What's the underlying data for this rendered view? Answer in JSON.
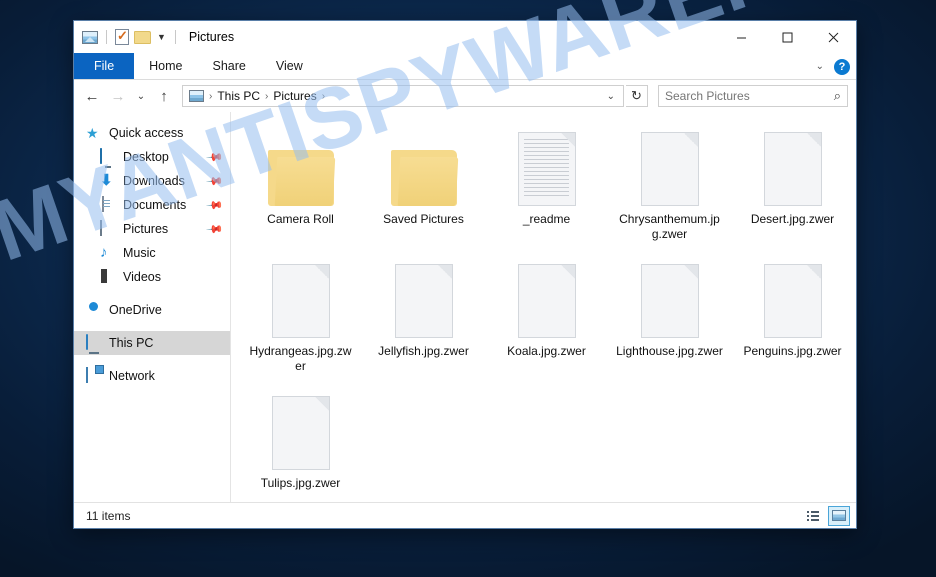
{
  "desktop": {
    "background_color": "#0b2344"
  },
  "watermark": {
    "text": "MYANTISPYWARE.COM"
  },
  "window": {
    "title": "Pictures",
    "quick_access_toolbar": [
      {
        "name": "pictures-library-icon",
        "label": "Pictures library"
      },
      {
        "name": "properties-icon",
        "label": "Properties"
      },
      {
        "name": "new-folder-icon",
        "label": "New folder"
      },
      {
        "name": "customize-chevron-icon",
        "label": "Customize Quick Access Toolbar"
      }
    ],
    "controls": {
      "minimize": "Minimize",
      "maximize": "Maximize",
      "close": "Close"
    }
  },
  "ribbon": {
    "tabs": [
      {
        "label": "File",
        "selected": true
      },
      {
        "label": "Home",
        "selected": false
      },
      {
        "label": "Share",
        "selected": false
      },
      {
        "label": "View",
        "selected": false
      }
    ],
    "expand_label": "Expand the Ribbon",
    "help_label": "?"
  },
  "addressbar": {
    "back": "Back",
    "forward": "Forward",
    "recent": "Recent locations",
    "up": "Up",
    "breadcrumb": [
      "This PC",
      "Pictures"
    ],
    "breadcrumb_separator": "›",
    "refresh": "Refresh",
    "dropdown": "Previous locations"
  },
  "search": {
    "placeholder": "Search Pictures",
    "value": "",
    "icon": "search-icon"
  },
  "sidebar": {
    "items": [
      {
        "label": "Quick access",
        "icon": "star-icon",
        "indent": false,
        "pinned": false,
        "selected": false
      },
      {
        "label": "Desktop",
        "icon": "monitor-icon",
        "indent": true,
        "pinned": true,
        "selected": false
      },
      {
        "label": "Downloads",
        "icon": "download-arrow-icon",
        "indent": true,
        "pinned": true,
        "selected": false
      },
      {
        "label": "Documents",
        "icon": "document-icon",
        "indent": true,
        "pinned": true,
        "selected": false
      },
      {
        "label": "Pictures",
        "icon": "picture-icon",
        "indent": true,
        "pinned": true,
        "selected": false
      },
      {
        "label": "Music",
        "icon": "music-note-icon",
        "indent": true,
        "pinned": false,
        "selected": false
      },
      {
        "label": "Videos",
        "icon": "video-film-icon",
        "indent": true,
        "pinned": false,
        "selected": false
      },
      {
        "label": "OneDrive",
        "icon": "cloud-icon",
        "indent": false,
        "pinned": false,
        "selected": false
      },
      {
        "label": "This PC",
        "icon": "computer-icon",
        "indent": false,
        "pinned": false,
        "selected": true
      },
      {
        "label": "Network",
        "icon": "network-icon",
        "indent": false,
        "pinned": false,
        "selected": false
      }
    ]
  },
  "files": {
    "items": [
      {
        "name": "Camera Roll",
        "type": "folder"
      },
      {
        "name": "Saved Pictures",
        "type": "folder"
      },
      {
        "name": "_readme",
        "type": "textfile"
      },
      {
        "name": "Chrysanthemum.jpg.zwer",
        "type": "encrypted"
      },
      {
        "name": "Desert.jpg.zwer",
        "type": "encrypted"
      },
      {
        "name": "Hydrangeas.jpg.zwer",
        "type": "encrypted"
      },
      {
        "name": "Jellyfish.jpg.zwer",
        "type": "encrypted"
      },
      {
        "name": "Koala.jpg.zwer",
        "type": "encrypted"
      },
      {
        "name": "Lighthouse.jpg.zwer",
        "type": "encrypted"
      },
      {
        "name": "Penguins.jpg.zwer",
        "type": "encrypted"
      },
      {
        "name": "Tulips.jpg.zwer",
        "type": "encrypted"
      }
    ]
  },
  "statusbar": {
    "item_count": "11 items",
    "views": [
      {
        "name": "details-view-button",
        "label": "Details view",
        "active": false
      },
      {
        "name": "large-icons-view-button",
        "label": "Large icons view",
        "active": true
      }
    ]
  }
}
